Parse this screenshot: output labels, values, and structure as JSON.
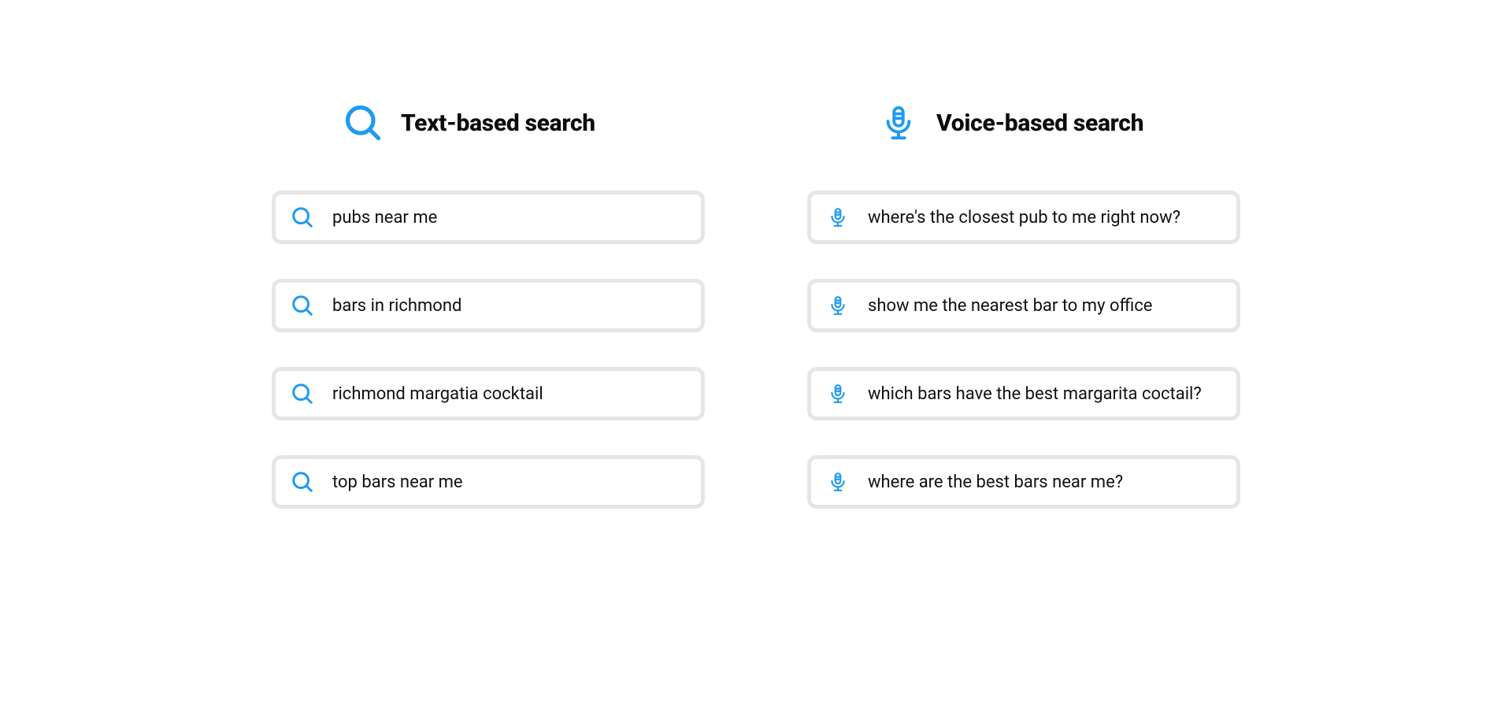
{
  "left": {
    "title": "Text-based search",
    "items": [
      "pubs near me",
      "bars in richmond",
      "richmond margatia cocktail",
      "top bars near me"
    ]
  },
  "right": {
    "title": "Voice-based search",
    "items": [
      "where's the closest pub to me right now?",
      "show me the nearest bar to my office",
      "which bars have the best margarita coctail?",
      "where are the best bars near me?"
    ]
  },
  "colors": {
    "accent": "#1e9bf0",
    "border": "#e5e5e5"
  }
}
